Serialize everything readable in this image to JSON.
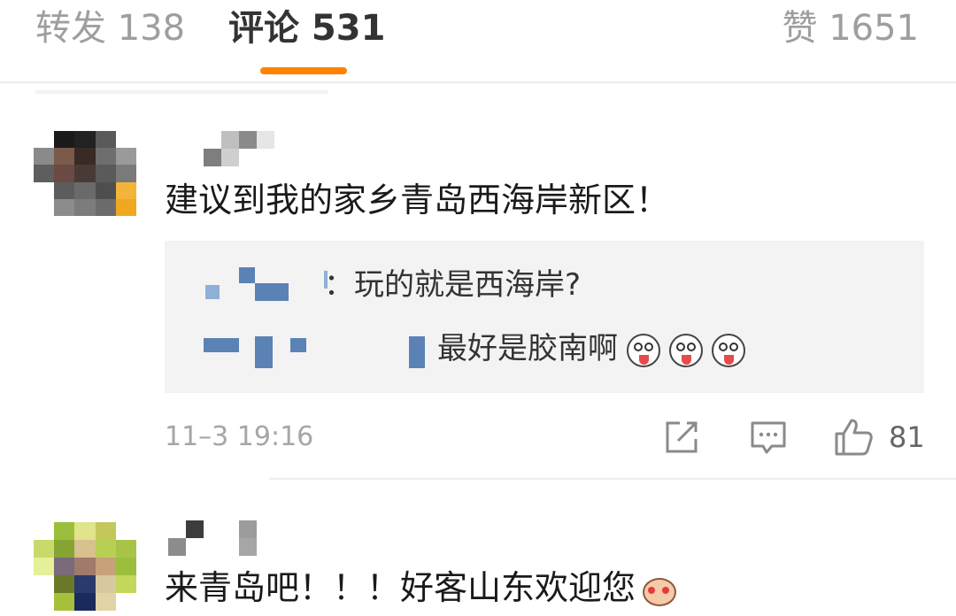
{
  "tabs": {
    "repost": "转发 138",
    "comments": "评论 531",
    "likes": "赞 1651"
  },
  "comments": [
    {
      "text": "建议到我的家乡青岛西海岸新区！",
      "replies": [
        {
          "text": "：玩的就是西海岸?"
        },
        {
          "text": "最好是胶南啊",
          "emojis": [
            "laughing-tongue-emoji",
            "laughing-tongue-emoji",
            "laughing-tongue-emoji"
          ]
        }
      ],
      "timestamp": "11–3 19:16",
      "like_count": "81",
      "actions": [
        "repost-icon",
        "comment-icon",
        "thumbs-up-icon"
      ]
    },
    {
      "text": "来青岛吧！！！好客山东欢迎您",
      "emojis": [
        "pig-heart-emoji"
      ]
    }
  ],
  "colors": {
    "accent": "#ff8200",
    "tab_inactive": "#9e9e9e",
    "reply_bg": "#f3f3f3",
    "redaction_blue": "#5b82b5"
  }
}
